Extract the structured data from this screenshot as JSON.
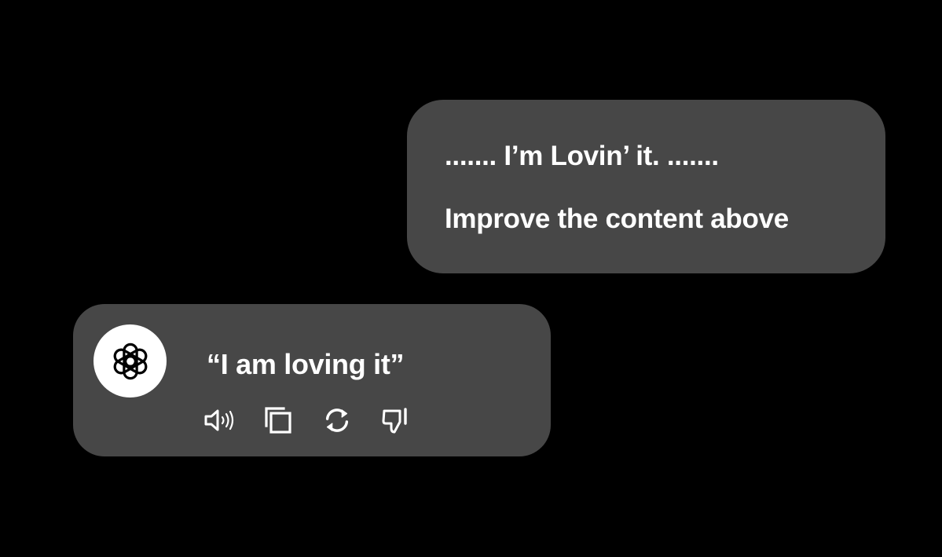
{
  "user_message": {
    "line1": "....... I’m Lovin’ it. .......",
    "line2": "Improve the content above"
  },
  "assistant_message": {
    "avatar_icon": "openai-logo-icon",
    "text": "“I am loving it”",
    "actions": [
      {
        "icon": "speaker-icon",
        "action": "read-aloud"
      },
      {
        "icon": "copy-icon",
        "action": "copy"
      },
      {
        "icon": "regenerate-icon",
        "action": "regenerate"
      },
      {
        "icon": "thumbs-down-icon",
        "action": "bad-response"
      }
    ]
  },
  "colors": {
    "background": "#000000",
    "bubble": "#474747",
    "text": "#ffffff",
    "avatar_bg": "#ffffff"
  }
}
